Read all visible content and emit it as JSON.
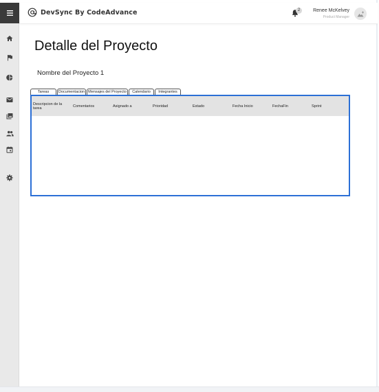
{
  "header": {
    "brand_title": "DevSync By CodeAdvance",
    "notification_count": "2",
    "user_name": "Renee McKelvey",
    "user_role": "Product Manager"
  },
  "sidebar": {
    "items": [
      {
        "icon": "home-icon"
      },
      {
        "icon": "flag-icon"
      },
      {
        "icon": "pie-chart-icon"
      },
      {
        "icon": "mail-icon"
      },
      {
        "icon": "photo-library-icon"
      },
      {
        "icon": "people-icon"
      },
      {
        "icon": "calendar-icon"
      },
      {
        "icon": "settings-icon"
      }
    ]
  },
  "main": {
    "page_title": "Detalle del Proyecto",
    "project_name": "Nombre del Proyecto 1",
    "tabs": [
      {
        "label": "Tareas"
      },
      {
        "label": "Documentacion"
      },
      {
        "label": "Mensajes del Proyecto"
      },
      {
        "label": "Calendario"
      },
      {
        "label": "Integrantes"
      }
    ],
    "table": {
      "columns": [
        "Descripcion de la tarea",
        "Comentarios",
        "Asignado a",
        "Prioridad",
        "Estado",
        "Fecha Inicio",
        "FechaFin",
        "Sprint"
      ],
      "rows": []
    }
  },
  "colors": {
    "accent_border": "#2b6fd6",
    "sidebar_bg": "#e9e9e9",
    "menu_button_bg": "#3a3a3a",
    "table_header_bg": "#e3e3e3"
  }
}
